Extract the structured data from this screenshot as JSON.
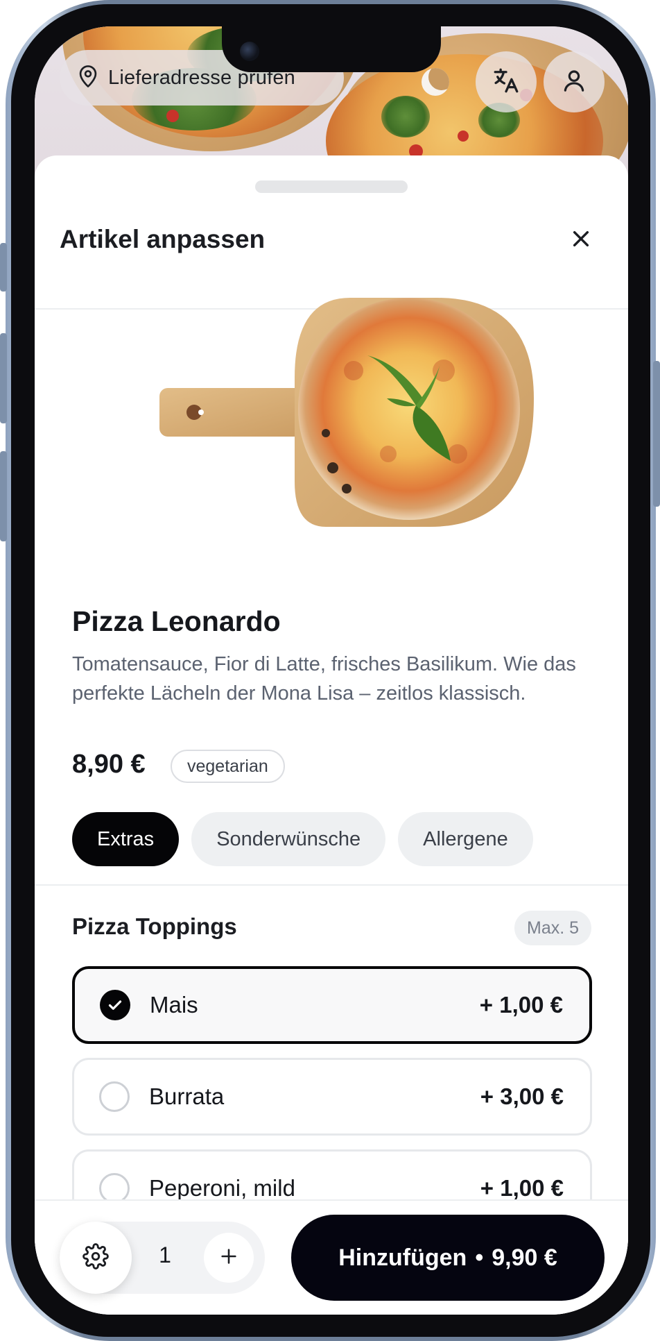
{
  "header": {
    "address_label": "Lieferadresse prüfen"
  },
  "sheet": {
    "title": "Artikel anpassen"
  },
  "product": {
    "name": "Pizza Leonardo",
    "description": "Tomatensauce, Fior di Latte, frisches Basilikum. Wie das perfekte Lächeln der Mona Lisa – zeitlos klassisch.",
    "price": "8,90 €",
    "tag": "vegetarian"
  },
  "tabs": [
    {
      "label": "Extras",
      "active": true
    },
    {
      "label": "Sonderwünsche",
      "active": false
    },
    {
      "label": "Allergene",
      "active": false
    }
  ],
  "toppings": {
    "title": "Pizza Toppings",
    "max_label": "Max. 5",
    "options": [
      {
        "label": "Mais",
        "price": "+ 1,00 €",
        "selected": true
      },
      {
        "label": "Burrata",
        "price": "+ 3,00 €",
        "selected": false
      },
      {
        "label": "Peperoni, mild",
        "price": "+ 1,00 €",
        "selected": false
      }
    ]
  },
  "footer": {
    "quantity": "1",
    "add_label": "Hinzufügen",
    "separator": "•",
    "total": "9,90 €"
  },
  "icons": {
    "location": "location-pin-icon",
    "translate": "translate-icon",
    "user": "user-icon",
    "close": "close-icon",
    "check": "check-icon",
    "settings": "gear-icon",
    "plus": "plus-icon"
  },
  "colors": {
    "primary": "#050507",
    "muted_text": "#5b6270",
    "chip_bg": "#eef0f2",
    "frame": "#7d90aa"
  }
}
